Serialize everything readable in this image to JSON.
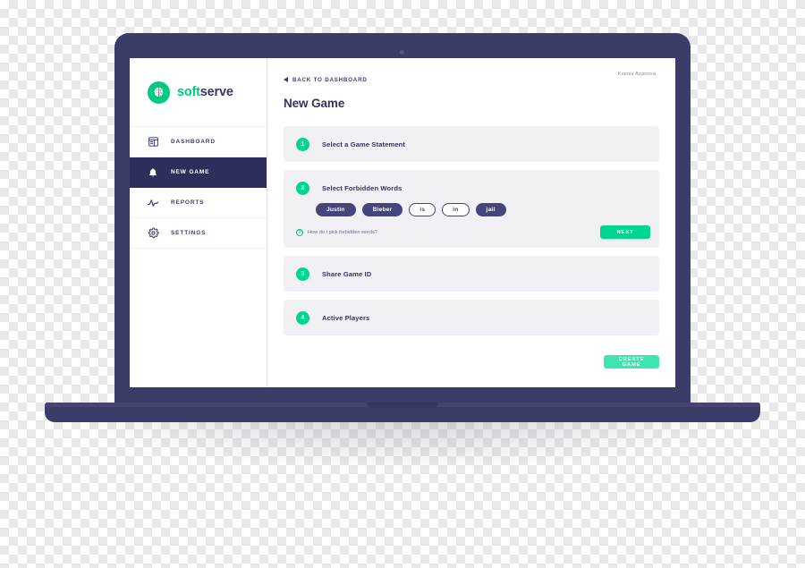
{
  "brand": {
    "logo_icon": "brain-circle-icon",
    "name_part_one": "soft",
    "name_part_two": "serve",
    "accent_green": "#00c980",
    "navy": "#37376b"
  },
  "sidebar": {
    "items": [
      {
        "label": "DASHBOARD",
        "icon": "dashboard-list-icon",
        "active": false
      },
      {
        "label": "NEW GAME",
        "icon": "bell-icon",
        "active": true
      },
      {
        "label": "REPORTS",
        "icon": "activity-pulse-icon",
        "active": false
      },
      {
        "label": "SETTINGS",
        "icon": "gear-icon",
        "active": false
      }
    ]
  },
  "topbar": {
    "back_label": "BACK TO DASHBOARD",
    "back_icon": "caret-left-icon",
    "user_name": "Ksenia Azanova"
  },
  "page": {
    "title": "New Game"
  },
  "steps": [
    {
      "number": "1",
      "title": "Select a Game Statement"
    },
    {
      "number": "2",
      "title": "Select Forbidden Words"
    },
    {
      "number": "3",
      "title": "Share Game ID"
    },
    {
      "number": "4",
      "title": "Active Players"
    }
  ],
  "forbidden_words": [
    {
      "word": "Justin",
      "selected": true
    },
    {
      "word": "Bieber",
      "selected": true
    },
    {
      "word": "is",
      "selected": false
    },
    {
      "word": "in",
      "selected": false
    },
    {
      "word": "jail",
      "selected": true
    }
  ],
  "help": {
    "icon": "question-circle-icon",
    "label": "How do I pick forbidden words?"
  },
  "buttons": {
    "next": "NEXT",
    "create_game": "CREATE GAME",
    "next_color": "#00d68f",
    "create_game_color": "#3fe5b0"
  },
  "colors": {
    "card_background": "#f0f0f5",
    "step_badge_green": "#00d68f",
    "pill_navy": "#45457e",
    "laptop_navy": "#3c3c68",
    "nav_active_navy": "#2e2e5c"
  }
}
